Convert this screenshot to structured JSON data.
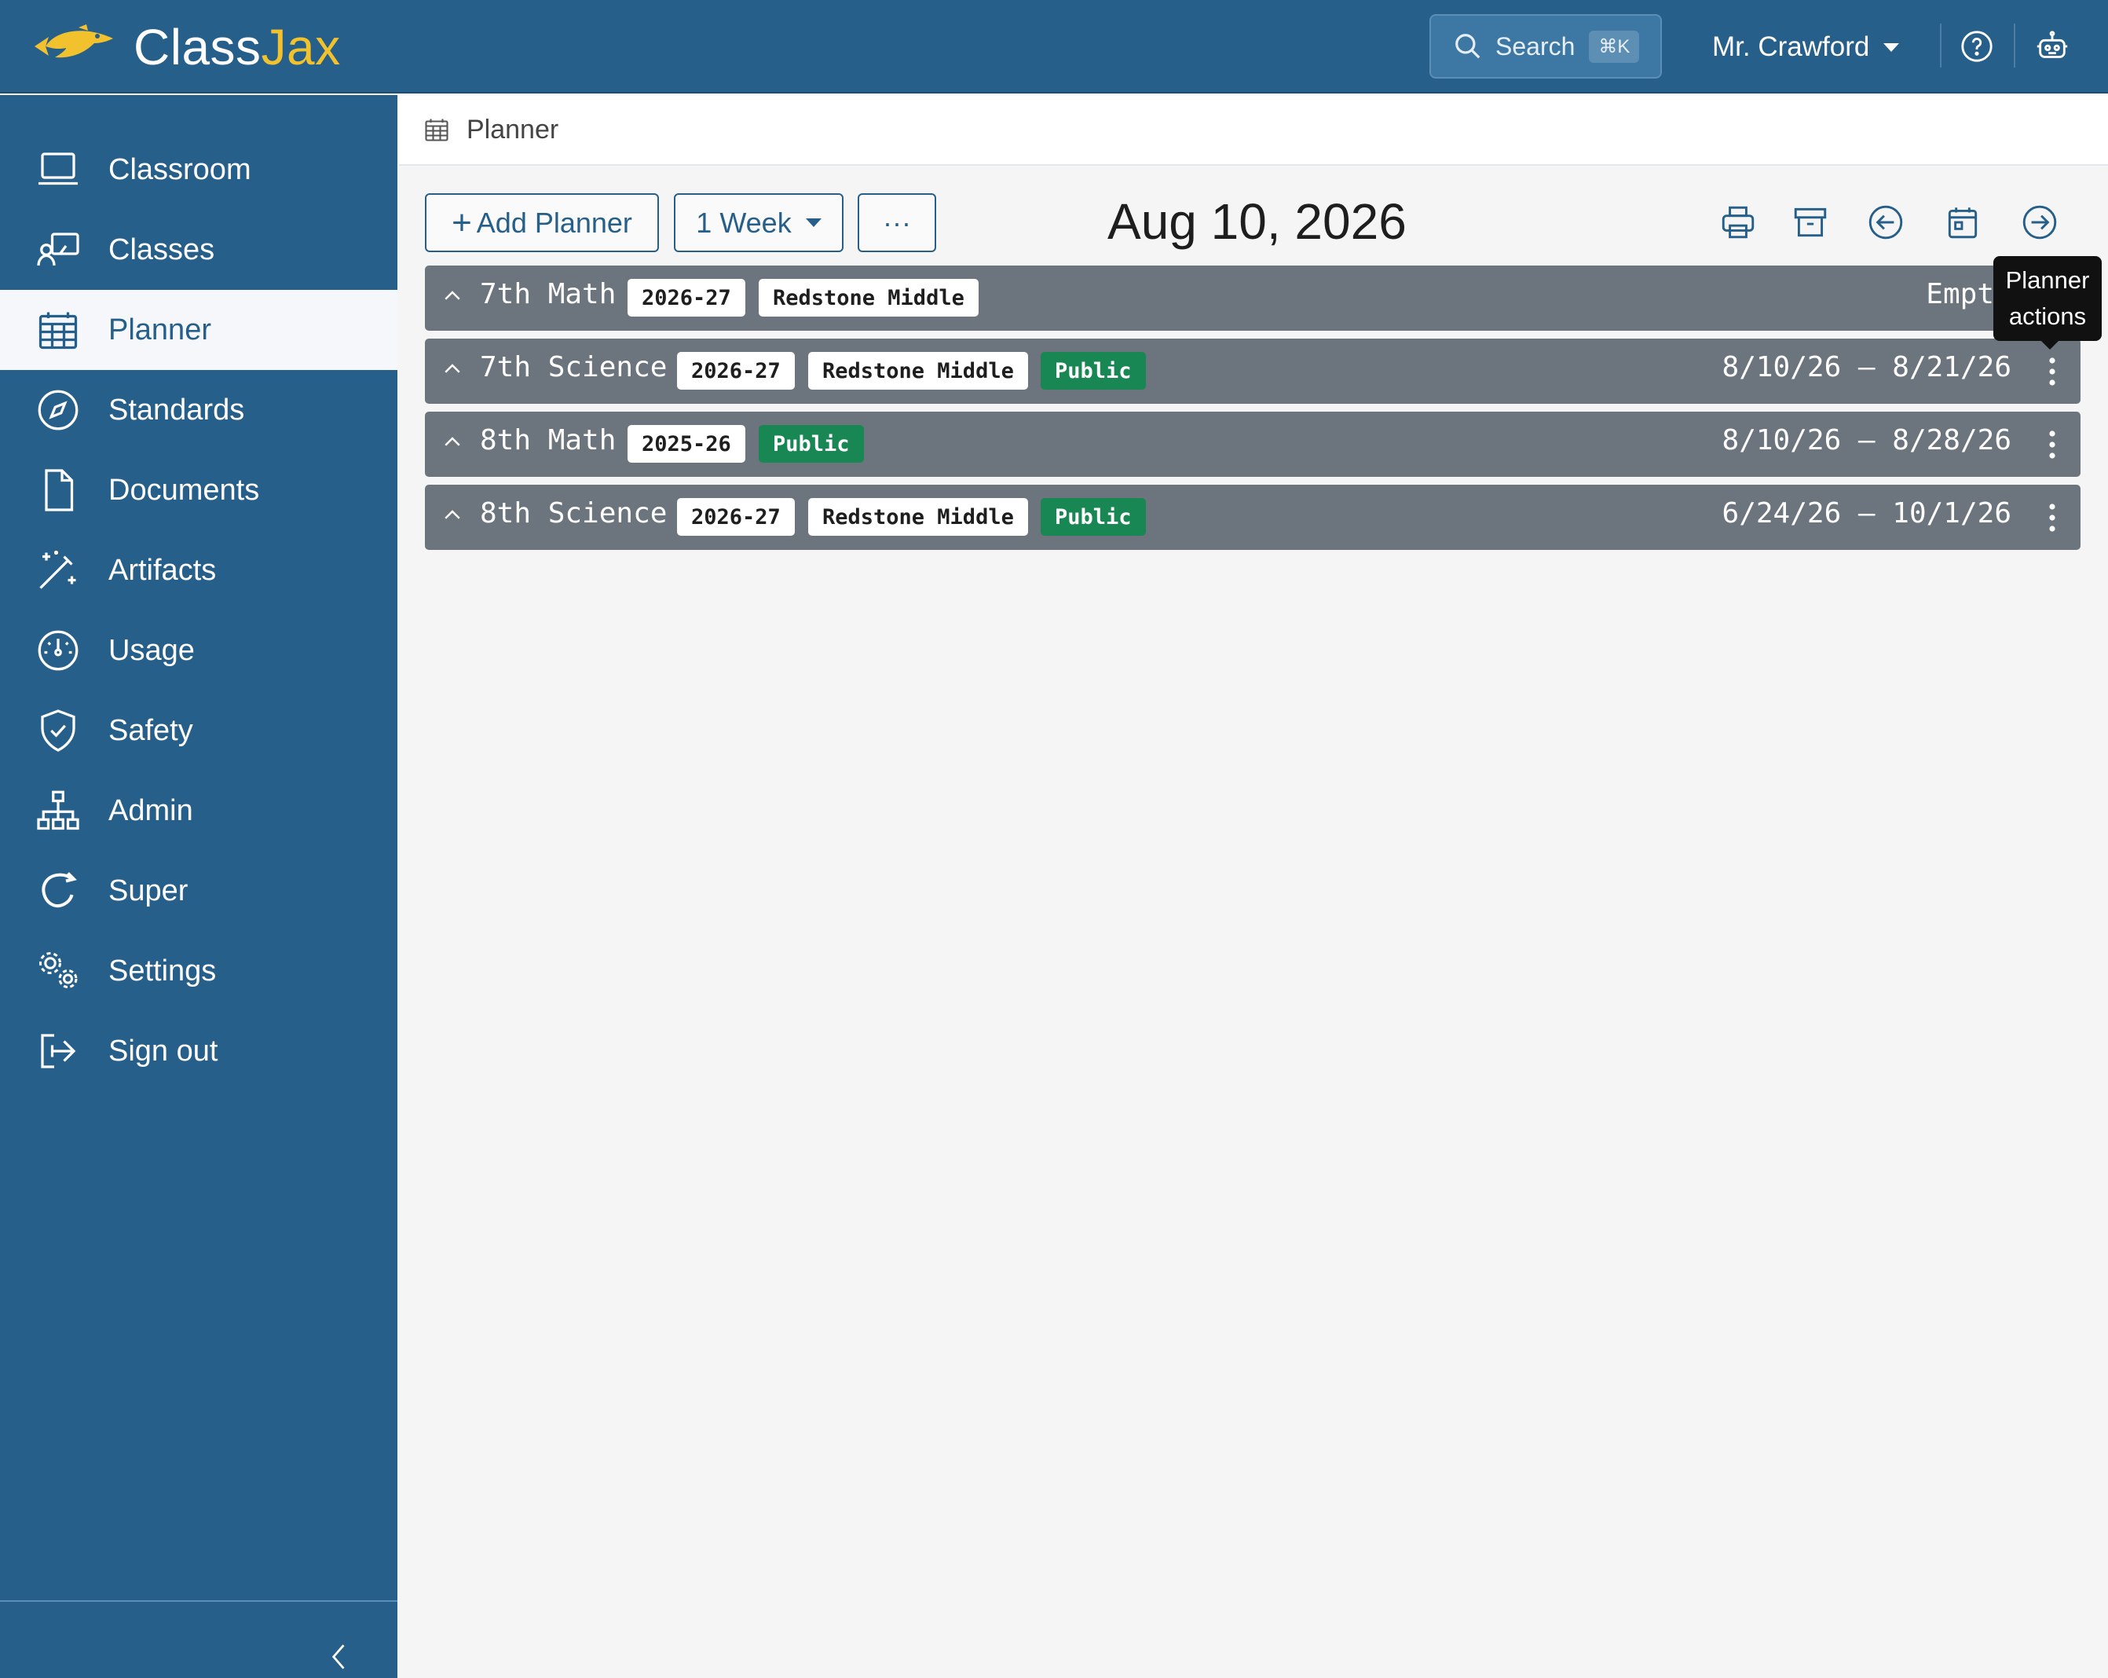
{
  "app": {
    "brand_part1": "Class",
    "brand_part2": "Jax",
    "logo_icon": "fish-logo-icon",
    "brand_color": "#265f8a",
    "accent_color": "#f2c12e"
  },
  "topbar": {
    "search_label": "Search",
    "search_shortcut": "⌘K",
    "user_name": "Mr. Crawford",
    "icons": [
      "search-icon",
      "help-icon",
      "robot-icon"
    ]
  },
  "sidebar": {
    "items": [
      {
        "label": "Classroom",
        "icon": "laptop-icon"
      },
      {
        "label": "Classes",
        "icon": "presentation-icon"
      },
      {
        "label": "Planner",
        "icon": "calendar-icon",
        "active": true
      },
      {
        "label": "Standards",
        "icon": "compass-icon"
      },
      {
        "label": "Documents",
        "icon": "file-icon"
      },
      {
        "label": "Artifacts",
        "icon": "magic-wand-icon"
      },
      {
        "label": "Usage",
        "icon": "speedometer-icon"
      },
      {
        "label": "Safety",
        "icon": "shield-check-icon"
      },
      {
        "label": "Admin",
        "icon": "org-chart-icon"
      },
      {
        "label": "Super",
        "icon": "super-icon"
      },
      {
        "label": "Settings",
        "icon": "gears-icon"
      },
      {
        "label": "Sign out",
        "icon": "sign-out-icon"
      }
    ]
  },
  "breadcrumb": {
    "label": "Planner"
  },
  "toolbar": {
    "add_planner": "Add Planner",
    "add_prefix": "+",
    "range_select": "1 Week",
    "more": "···",
    "date_title": "Aug 10, 2026",
    "icons": [
      "printer-icon",
      "archive-icon",
      "prev-arrow-icon",
      "calendar-today-icon",
      "next-arrow-icon"
    ]
  },
  "planners": [
    {
      "name": "7th Math",
      "year": "2026-27",
      "school": "Redstone Middle",
      "public": "",
      "range": "Empt"
    },
    {
      "name": "7th Science",
      "year": "2026-27",
      "school": "Redstone Middle",
      "public": "Public",
      "range": "8/10/26 – 8/21/26"
    },
    {
      "name": "8th Math",
      "year": "2025-26",
      "school": "",
      "public": "Public",
      "range": "8/10/26 – 8/28/26"
    },
    {
      "name": "8th Science",
      "year": "2026-27",
      "school": "Redstone Middle",
      "public": "Public",
      "range": "6/24/26 – 10/1/26"
    }
  ],
  "tooltip": {
    "line1": "Planner",
    "line2": "actions"
  }
}
